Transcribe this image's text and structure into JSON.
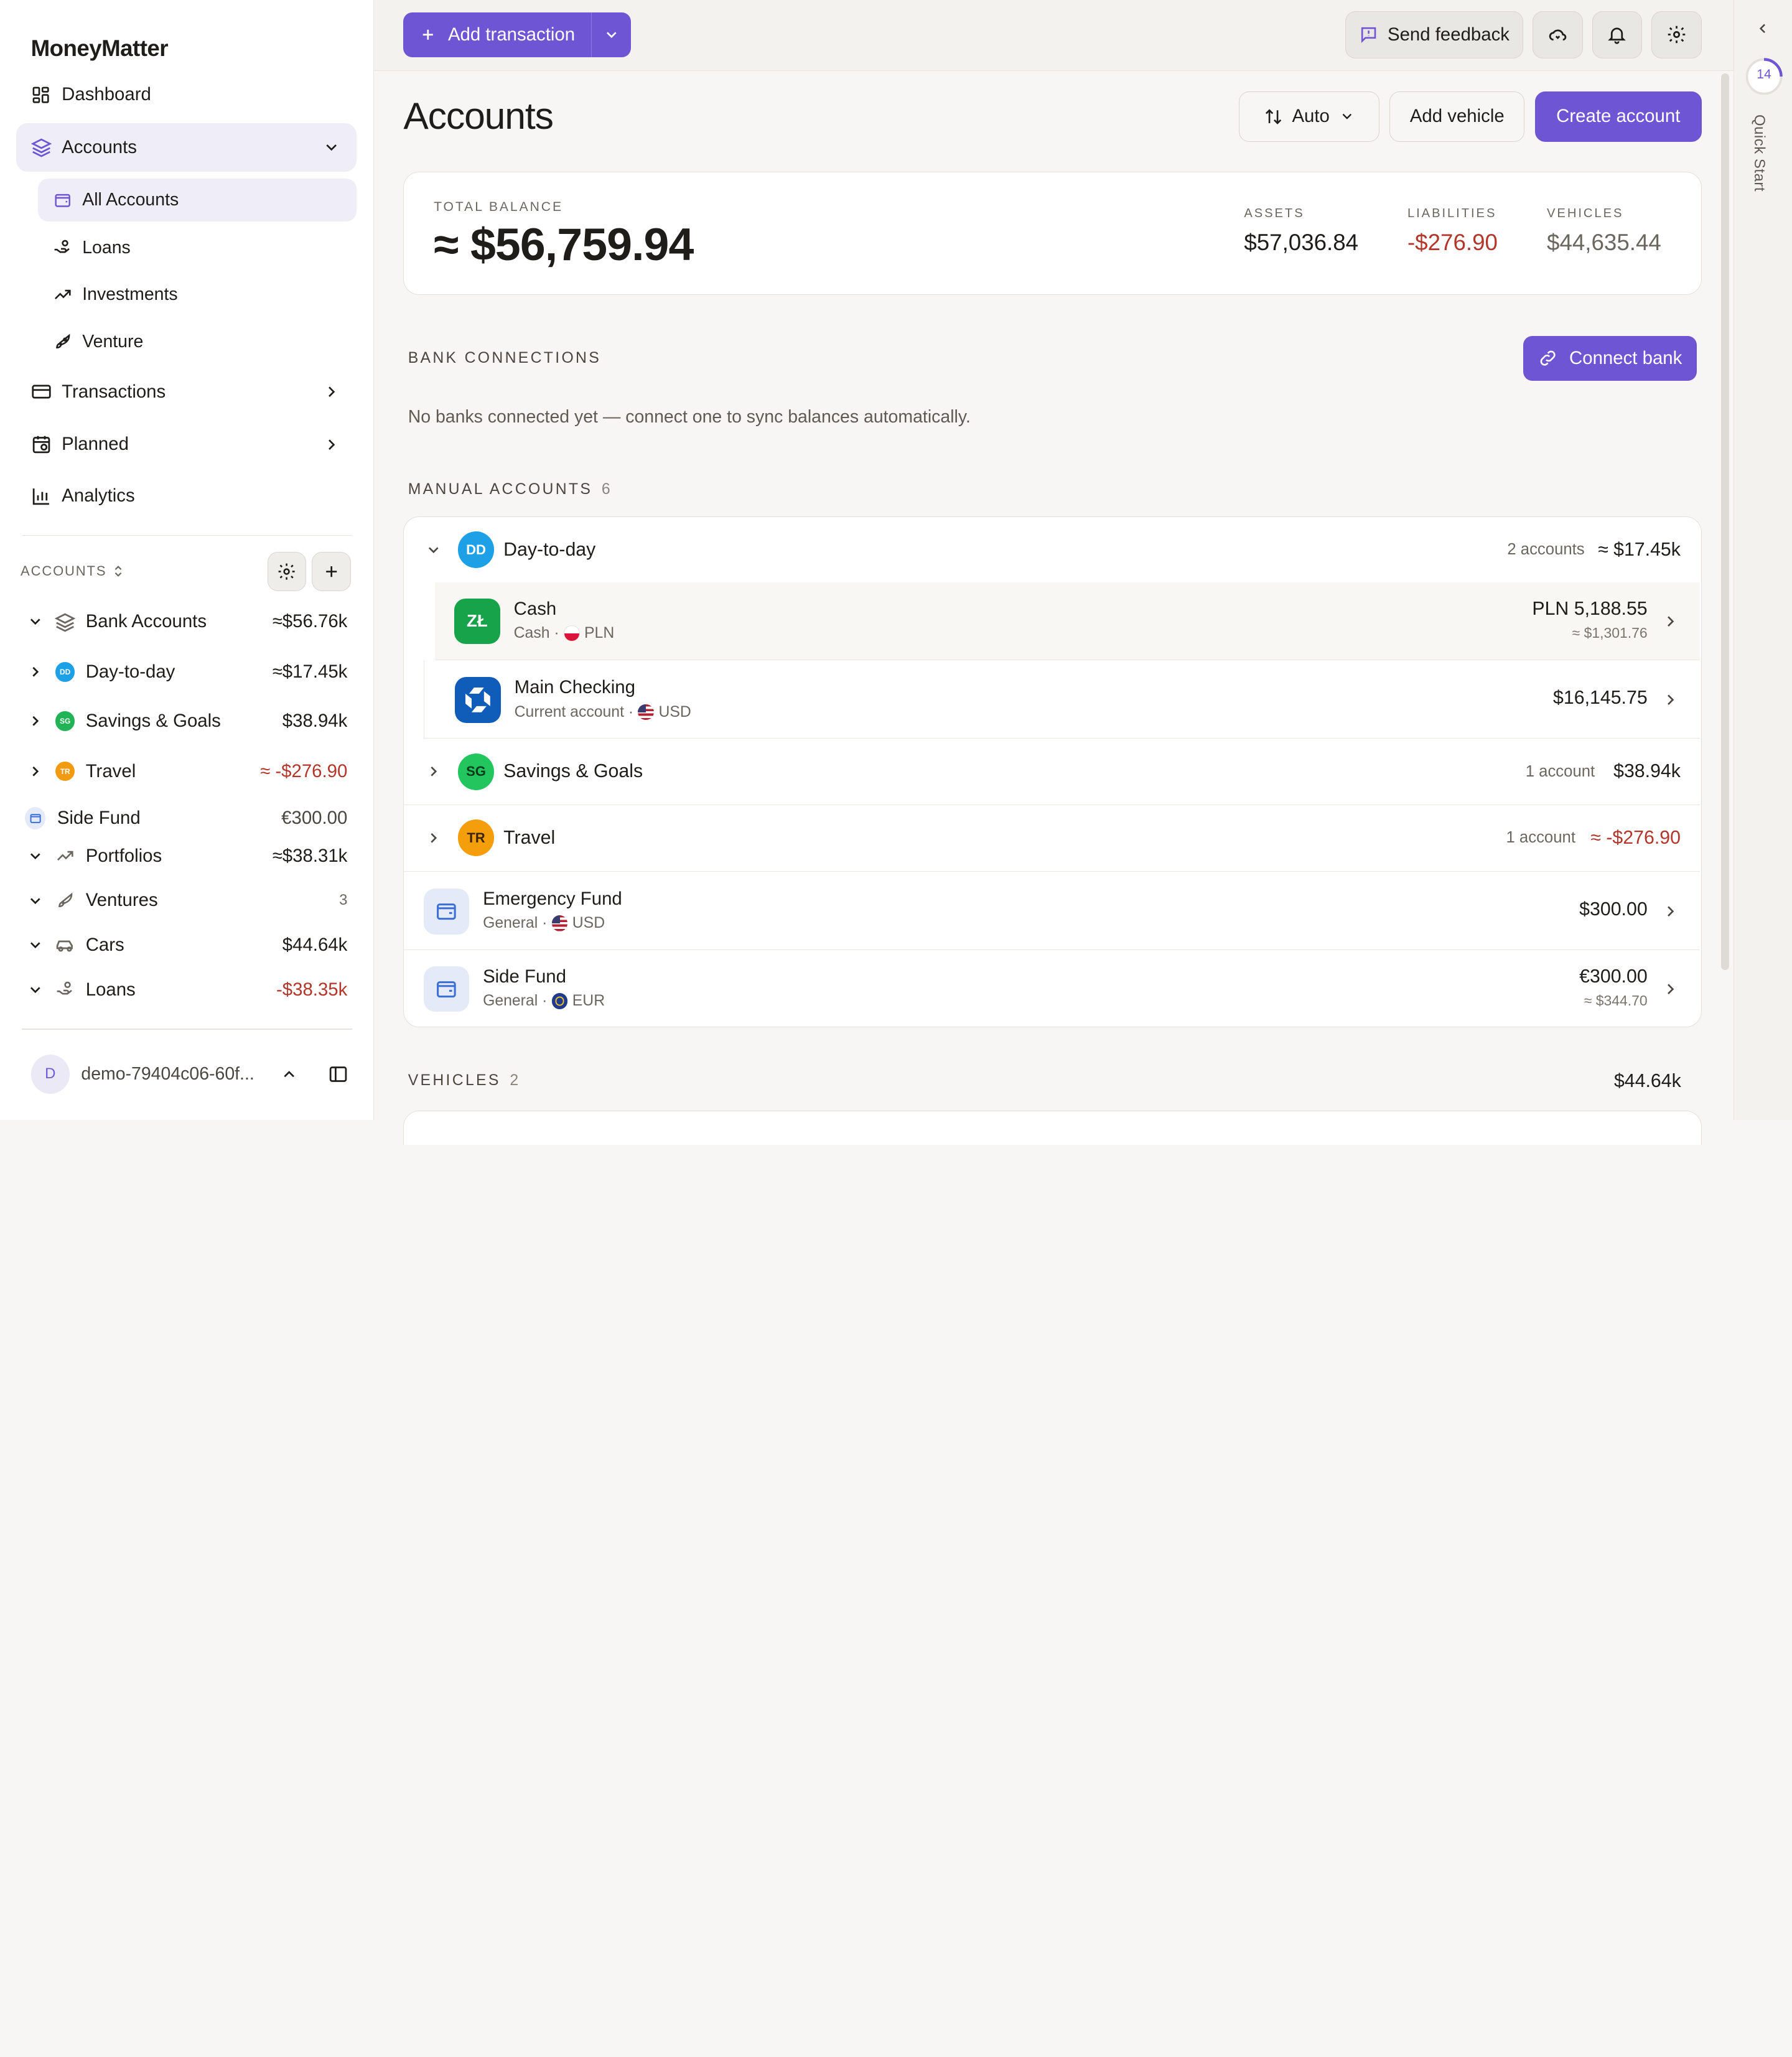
{
  "app": {
    "name": "MoneyMatter"
  },
  "colors": {
    "accent": "#6d55d4",
    "negative": "#b3362b",
    "page_bg": "#f7f6f4"
  },
  "sidebar": {
    "nav": {
      "dashboard": "Dashboard",
      "accounts": "Accounts",
      "all_accounts": "All Accounts",
      "loans": "Loans",
      "investments": "Investments",
      "venture": "Venture",
      "transactions": "Transactions",
      "planned": "Planned",
      "analytics": "Analytics"
    },
    "accounts_header": "ACCOUNTS",
    "tree": [
      {
        "label": "Bank Accounts",
        "value": "≈$56.76k",
        "icon": "layers-icon"
      },
      {
        "label": "Day-to-day",
        "value": "≈$17.45k",
        "badge": "DD",
        "badge_color": "#1ea0e6"
      },
      {
        "label": "Savings & Goals",
        "value": "$38.94k",
        "badge": "SG",
        "badge_color": "#22b357"
      },
      {
        "label": "Travel",
        "value": "≈ -$276.90",
        "badge": "TR",
        "badge_color": "#f29a12"
      },
      {
        "label": "Side Fund",
        "value": "€300.00",
        "icon": "wallet-icon"
      },
      {
        "label": "Portfolios",
        "value": "≈$38.31k",
        "icon": "trend-icon"
      },
      {
        "label": "Ventures",
        "value": "3",
        "icon": "rocket-icon"
      },
      {
        "label": "Cars",
        "value": "$44.64k",
        "icon": "car-icon"
      },
      {
        "label": "Loans",
        "value": "-$38.35k",
        "icon": "loan-icon"
      }
    ],
    "user": {
      "initial": "D",
      "name": "demo-79404c06-60f..."
    }
  },
  "topbar": {
    "add_transaction": "Add transaction",
    "send_feedback": "Send feedback"
  },
  "page": {
    "title": "Accounts",
    "sort_label": "Auto",
    "add_vehicle": "Add vehicle",
    "create_account": "Create account"
  },
  "summary": {
    "total_label": "TOTAL BALANCE",
    "total_value": "≈ $56,759.94",
    "assets_label": "ASSETS",
    "assets_value": "$57,036.84",
    "liabilities_label": "LIABILITIES",
    "liabilities_value": "-$276.90",
    "vehicles_label": "VEHICLES",
    "vehicles_value": "$44,635.44"
  },
  "bank_connections": {
    "label": "BANK CONNECTIONS",
    "connect_button": "Connect bank",
    "empty": "No banks connected yet — connect one to sync balances automatically."
  },
  "manual_accounts": {
    "label": "MANUAL ACCOUNTS",
    "count": "6",
    "groups": [
      {
        "badge": "DD",
        "name": "Day-to-day",
        "meta": "2 accounts",
        "value": "≈ $17.45k",
        "color": "#1ea0e6"
      },
      {
        "badge": "SG",
        "name": "Savings & Goals",
        "meta": "1 account",
        "value": "$38.94k",
        "color": "#22c55e"
      },
      {
        "badge": "TR",
        "name": "Travel",
        "meta": "1 account",
        "value": "≈ -$276.90",
        "color": "#f59e0b"
      }
    ],
    "accounts": [
      {
        "icon_text": "ZŁ",
        "name": "Cash",
        "type": "Cash ·",
        "currency": "PLN",
        "value": "PLN 5,188.55",
        "converted": "≈ $1,301.76"
      },
      {
        "name": "Main Checking",
        "type": "Current account ·",
        "currency": "USD",
        "value": "$16,145.75"
      },
      {
        "name": "Emergency Fund",
        "type": "General ·",
        "currency": "USD",
        "value": "$300.00"
      },
      {
        "name": "Side Fund",
        "type": "General ·",
        "currency": "EUR",
        "value": "€300.00",
        "converted": "≈ $344.70"
      }
    ]
  },
  "vehicles": {
    "label": "VEHICLES",
    "count": "2",
    "value": "$44.64k"
  },
  "rail": {
    "progress": "14",
    "label": "Quick Start"
  }
}
